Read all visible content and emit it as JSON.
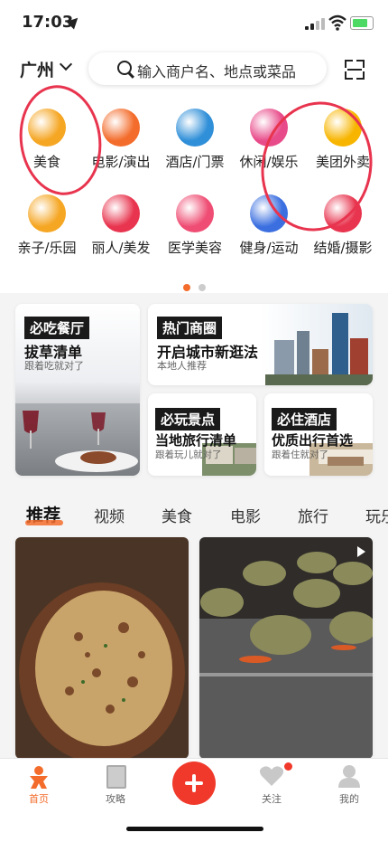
{
  "status_bar": {
    "time": "17:03"
  },
  "header": {
    "city": "广州",
    "search_placeholder": "输入商户名、地点或菜品"
  },
  "categories": [
    {
      "label": "美食",
      "icon": "roast-chicken-icon",
      "color": "#f5a623"
    },
    {
      "label": "电影/演出",
      "icon": "cat-mascot-icon",
      "color": "#f36c2b"
    },
    {
      "label": "酒店/门票",
      "icon": "building-icon",
      "color": "#2f8fd8"
    },
    {
      "label": "休闲/娱乐",
      "icon": "cocktail-icon",
      "color": "#e84b8a"
    },
    {
      "label": "美团外卖",
      "icon": "kangaroo-icon",
      "color": "#f7b500"
    },
    {
      "label": "亲子/乐园",
      "icon": "family-icon",
      "color": "#f5a623"
    },
    {
      "label": "丽人/美发",
      "icon": "woman-hair-icon",
      "color": "#e8344e"
    },
    {
      "label": "医学美容",
      "icon": "face-icon",
      "color": "#ef4d73"
    },
    {
      "label": "健身/运动",
      "icon": "dumbbell-icon",
      "color": "#3b6fe0"
    },
    {
      "label": "结婚/摄影",
      "icon": "ribbon-icon",
      "color": "#e8344e"
    }
  ],
  "page_dots": {
    "active": 1,
    "total": 2,
    "active_color": "#f36c2b"
  },
  "cards": {
    "must_eat": {
      "tag": "必吃餐厅",
      "title": "拔草清单",
      "sub": "跟着吃就对了"
    },
    "hot_mall": {
      "tag": "热门商圈",
      "title": "开启城市新逛法",
      "sub": "本地人推荐"
    },
    "must_play": {
      "tag": "必玩景点",
      "title": "当地旅行清单",
      "sub": "跟着玩儿就对了"
    },
    "must_stay": {
      "tag": "必住酒店",
      "title": "优质出行首选",
      "sub": "跟着住就对了"
    }
  },
  "feed_tabs": [
    "推荐",
    "视频",
    "美食",
    "电影",
    "旅行",
    "玩乐"
  ],
  "active_feed_tab": "推荐",
  "tabbar": [
    {
      "label": "首页",
      "icon": "home-mascot-icon"
    },
    {
      "label": "攻略",
      "icon": "book-icon"
    },
    {
      "label": "",
      "icon": "plus-icon"
    },
    {
      "label": "关注",
      "icon": "heart-icon"
    },
    {
      "label": "我的",
      "icon": "person-icon"
    }
  ],
  "accent": "#f36c2b"
}
